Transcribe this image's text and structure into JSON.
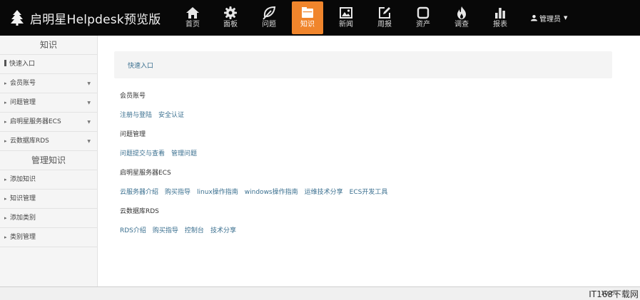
{
  "brand": {
    "title": "启明星Helpdesk预览版"
  },
  "nav": {
    "items": [
      {
        "label": "首页",
        "icon": "home-icon"
      },
      {
        "label": "面板",
        "icon": "gear-icon"
      },
      {
        "label": "问题",
        "icon": "leaf-icon"
      },
      {
        "label": "知识",
        "icon": "folder-icon",
        "active": true
      },
      {
        "label": "新闻",
        "icon": "picture-icon"
      },
      {
        "label": "周报",
        "icon": "edit-icon"
      },
      {
        "label": "资产",
        "icon": "stop-icon"
      },
      {
        "label": "调查",
        "icon": "fire-icon"
      },
      {
        "label": "报表",
        "icon": "bar-chart-icon"
      }
    ],
    "user_label": "管理员",
    "accent_color": "#f0852c"
  },
  "sidebar": {
    "section1_title": "知识",
    "section1_items": [
      {
        "label": "快速入口"
      },
      {
        "label": "会员账号"
      },
      {
        "label": "问题管理"
      },
      {
        "label": "启明星服务器ECS"
      },
      {
        "label": "云数据库RDS"
      }
    ],
    "section2_title": "管理知识",
    "section2_items": [
      {
        "label": "添加知识"
      },
      {
        "label": "知识管理"
      },
      {
        "label": "添加类别"
      },
      {
        "label": "类别管理"
      }
    ]
  },
  "main": {
    "quick_link": "快速入口",
    "sections": [
      {
        "title": "会员账号",
        "links": [
          "注册与登陆",
          "安全认证"
        ]
      },
      {
        "title": "问题管理",
        "links": [
          "问题提交与查看",
          "管理问题"
        ]
      },
      {
        "title": "启明星服务器ECS",
        "links": [
          "云服务器介绍",
          "购买指导",
          "linux操作指南",
          "windows操作指南",
          "运维技术分享",
          "ECS开发工具"
        ]
      },
      {
        "title": "云数据库RDS",
        "links": [
          "RDS介绍",
          "购买指导",
          "控制台",
          "技术分享"
        ]
      }
    ]
  },
  "status": {
    "zoom": "100%",
    "watermark": "IT168下载网"
  }
}
